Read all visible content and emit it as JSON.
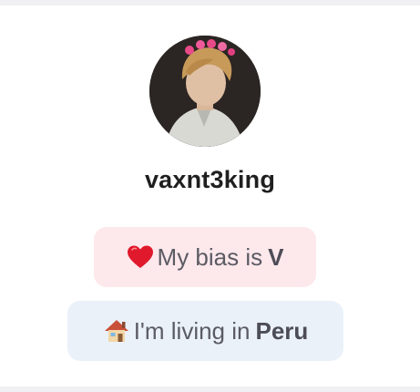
{
  "profile": {
    "username": "vaxnt3king",
    "avatar_icon": "profile-photo"
  },
  "bias_chip": {
    "icon": "red-heart-emoji",
    "text": "My bias is",
    "value": "V",
    "background": "#fde8ec"
  },
  "location_chip": {
    "icon": "house-emoji",
    "text": "I'm living in",
    "value": "Peru",
    "background": "#eaf1f9"
  }
}
